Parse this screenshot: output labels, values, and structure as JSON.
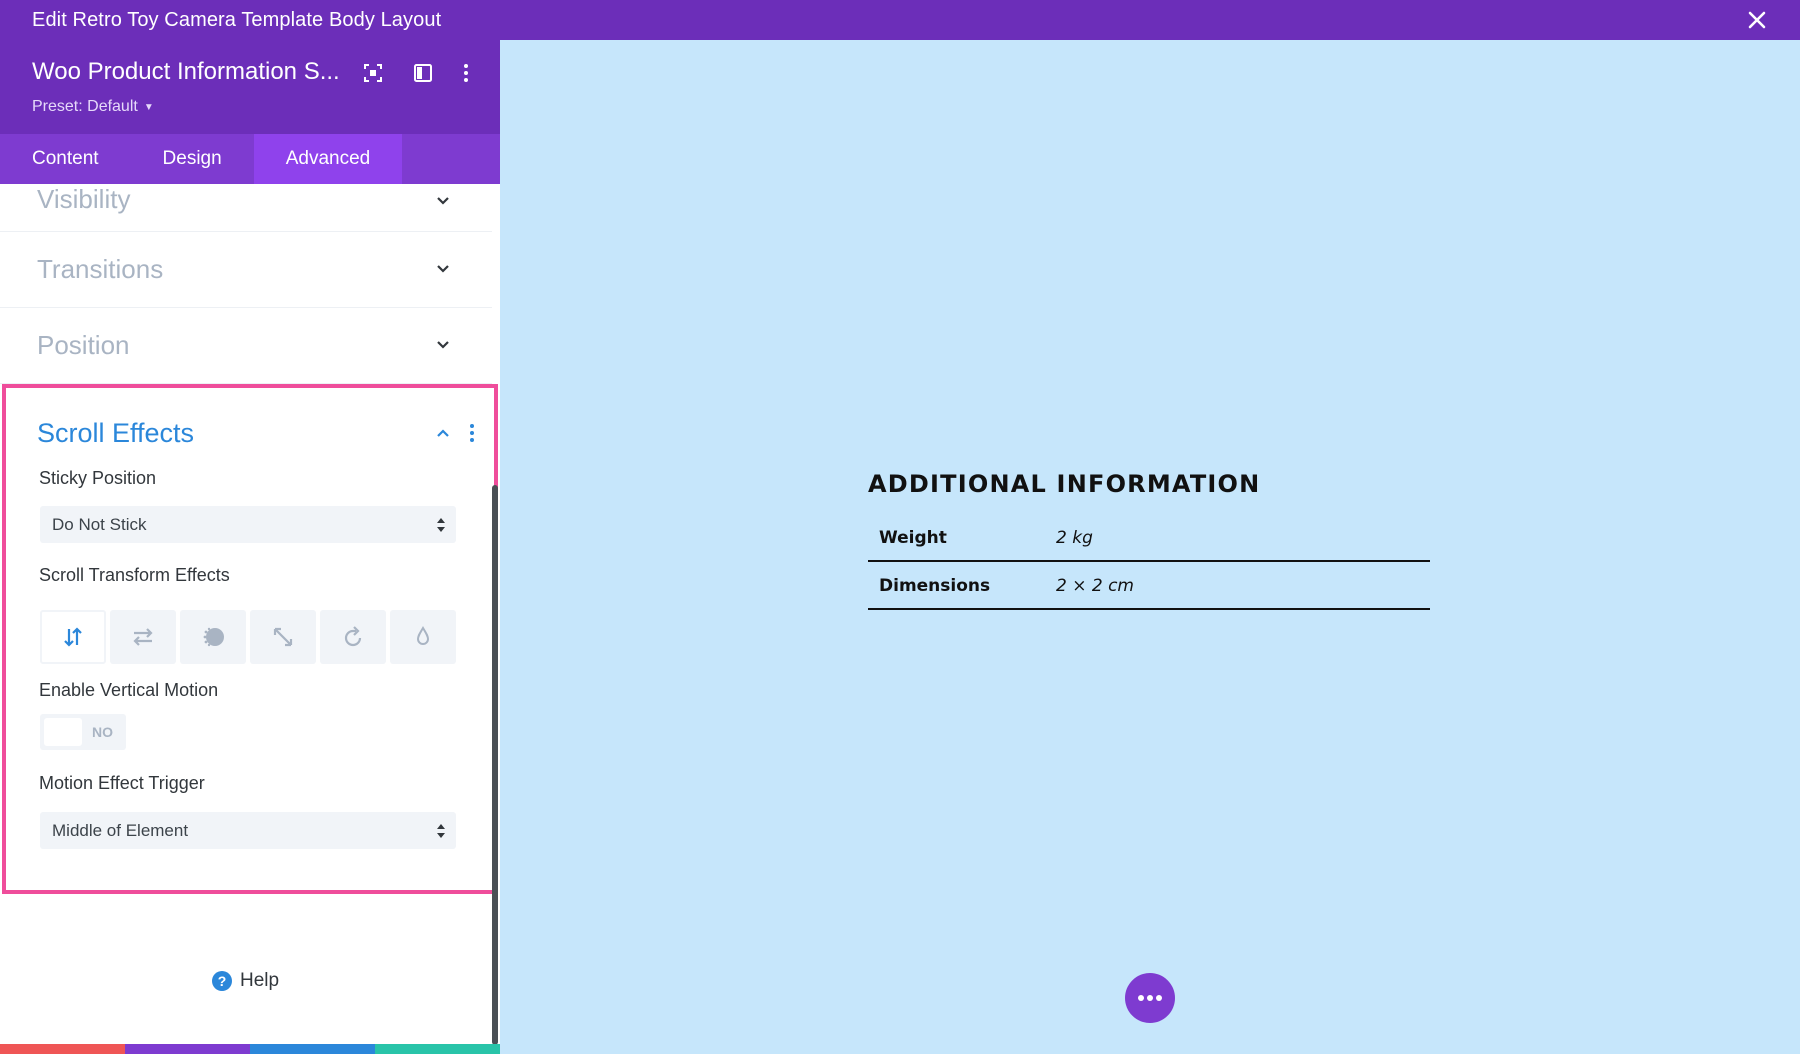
{
  "window": {
    "title": "Edit Retro Toy Camera Template Body Layout"
  },
  "panel": {
    "module_title": "Woo Product Information S...",
    "preset": "Preset: Default",
    "tabs": [
      {
        "label": "Content",
        "active": false
      },
      {
        "label": "Design",
        "active": false
      },
      {
        "label": "Advanced",
        "active": true
      }
    ],
    "sections": {
      "visibility": "Visibility",
      "transitions": "Transitions",
      "position": "Position"
    },
    "scroll_effects": {
      "title": "Scroll Effects",
      "sticky_position_label": "Sticky Position",
      "sticky_position_value": "Do Not Stick",
      "transform_label": "Scroll Transform Effects",
      "transform_effects": [
        "vertical-motion-icon",
        "horizontal-motion-icon",
        "fading-icon",
        "scaling-icon",
        "rotating-icon",
        "blur-icon"
      ],
      "vertical_motion_label": "Enable Vertical Motion",
      "vertical_motion_value": "NO",
      "trigger_label": "Motion Effect Trigger",
      "trigger_value": "Middle of Element"
    },
    "help": "Help"
  },
  "bottom_bar": {
    "colors": {
      "discard": "#ef5555",
      "undo": "#7e3bd0",
      "redo": "#2b87da",
      "save": "#29c4a9"
    }
  },
  "preview": {
    "heading": "ADDITIONAL INFORMATION",
    "rows": [
      {
        "key": "Weight",
        "value": "2 kg"
      },
      {
        "key": "Dimensions",
        "value": "2 × 2 cm"
      }
    ]
  },
  "colors": {
    "accent": "#6c2eb9",
    "tab_active": "#8f42ec",
    "highlight_border": "#ef4d9b",
    "section_title_active": "#2b87da",
    "preview_bg": "#c6e6fb"
  }
}
